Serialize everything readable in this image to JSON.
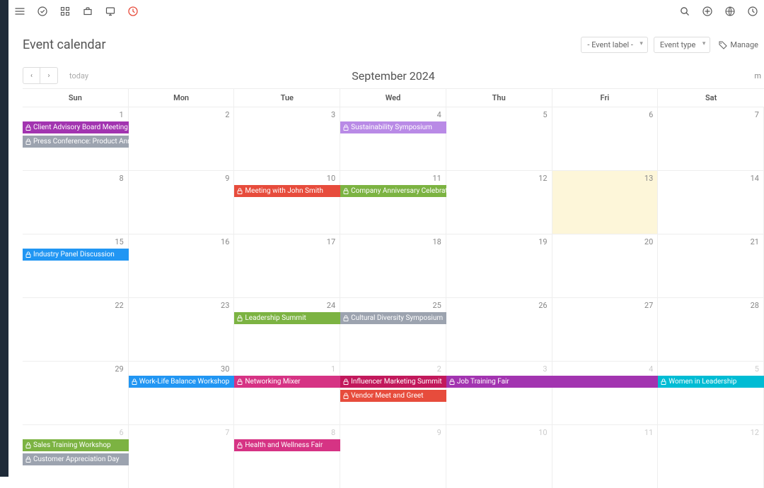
{
  "page": {
    "title": "Event calendar"
  },
  "filters": {
    "event_label": "- Event label -",
    "event_type": "Event type",
    "manage": "Manage"
  },
  "nav": {
    "today": "today",
    "month_title": "September 2024",
    "view_short": "m"
  },
  "day_headers": [
    "Sun",
    "Mon",
    "Tue",
    "Wed",
    "Thu",
    "Fri",
    "Sat"
  ],
  "weeks": [
    {
      "days": [
        {
          "n": "1"
        },
        {
          "n": "2"
        },
        {
          "n": "3"
        },
        {
          "n": "4"
        },
        {
          "n": "5"
        },
        {
          "n": "6"
        },
        {
          "n": "7"
        }
      ],
      "events": [
        [
          {
            "col": 0,
            "span": 1,
            "label": "Client Advisory Board Meeting",
            "color": "c-purple"
          },
          {
            "col": 3,
            "span": 1,
            "label": "Sustainability Symposium",
            "color": "c-lavender"
          }
        ],
        [
          {
            "col": 0,
            "span": 1,
            "label": "Press Conference: Product Announcement",
            "color": "c-gray"
          }
        ]
      ]
    },
    {
      "days": [
        {
          "n": "8"
        },
        {
          "n": "9"
        },
        {
          "n": "10"
        },
        {
          "n": "11"
        },
        {
          "n": "12"
        },
        {
          "n": "13",
          "today": true
        },
        {
          "n": "14"
        }
      ],
      "events": [
        [
          {
            "col": 2,
            "span": 1,
            "label": "Meeting with John Smith",
            "color": "c-red"
          },
          {
            "col": 3,
            "span": 1,
            "label": "Company Anniversary Celebration",
            "color": "c-green"
          }
        ]
      ]
    },
    {
      "days": [
        {
          "n": "15"
        },
        {
          "n": "16"
        },
        {
          "n": "17"
        },
        {
          "n": "18"
        },
        {
          "n": "19"
        },
        {
          "n": "20"
        },
        {
          "n": "21"
        }
      ],
      "events": [
        [
          {
            "col": 0,
            "span": 1,
            "label": "Industry Panel Discussion",
            "color": "c-blue"
          }
        ]
      ]
    },
    {
      "days": [
        {
          "n": "22"
        },
        {
          "n": "23"
        },
        {
          "n": "24"
        },
        {
          "n": "25"
        },
        {
          "n": "26"
        },
        {
          "n": "27"
        },
        {
          "n": "28"
        }
      ],
      "events": [
        [
          {
            "col": 2,
            "span": 1,
            "label": "Leadership Summit",
            "color": "c-green"
          },
          {
            "col": 3,
            "span": 1,
            "label": "Cultural Diversity Symposium",
            "color": "c-gray"
          }
        ]
      ]
    },
    {
      "days": [
        {
          "n": "29"
        },
        {
          "n": "30"
        },
        {
          "n": "1",
          "other": true
        },
        {
          "n": "2",
          "other": true
        },
        {
          "n": "3",
          "other": true
        },
        {
          "n": "4",
          "other": true
        },
        {
          "n": "5",
          "other": true
        }
      ],
      "events": [
        [
          {
            "col": 1,
            "span": 1,
            "label": "Work-Life Balance Workshop",
            "color": "c-blue"
          },
          {
            "col": 2,
            "span": 1,
            "label": "Networking Mixer",
            "color": "c-pink"
          },
          {
            "col": 3,
            "span": 1,
            "label": "Influencer Marketing Summit",
            "color": "c-magenta"
          },
          {
            "col": 4,
            "span": 2,
            "label": "Job Training Fair",
            "color": "c-purple"
          },
          {
            "col": 6,
            "span": 1,
            "label": "Women in Leadership",
            "color": "c-teal"
          }
        ],
        [
          {
            "col": 3,
            "span": 1,
            "label": "Vendor Meet and Greet",
            "color": "c-red"
          }
        ]
      ]
    },
    {
      "days": [
        {
          "n": "6",
          "other": true
        },
        {
          "n": "7",
          "other": true
        },
        {
          "n": "8",
          "other": true
        },
        {
          "n": "9",
          "other": true
        },
        {
          "n": "10",
          "other": true
        },
        {
          "n": "11",
          "other": true
        },
        {
          "n": "12",
          "other": true
        }
      ],
      "events": [
        [
          {
            "col": 0,
            "span": 1,
            "label": "Sales Training Workshop",
            "color": "c-green"
          },
          {
            "col": 2,
            "span": 1,
            "label": "Health and Wellness Fair",
            "color": "c-pink"
          }
        ],
        [
          {
            "col": 0,
            "span": 1,
            "label": "Customer Appreciation Day",
            "color": "c-gray"
          }
        ]
      ]
    }
  ]
}
